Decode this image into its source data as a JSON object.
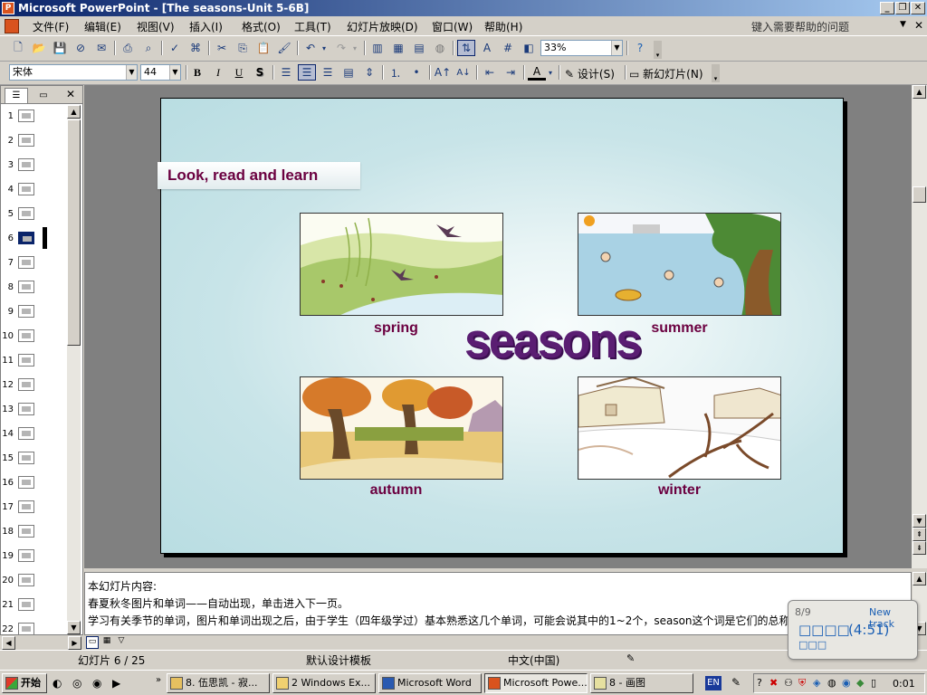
{
  "window": {
    "title": "Microsoft PowerPoint - [The seasons-Unit 5-6B]"
  },
  "menu": {
    "items": [
      "文件(F)",
      "编辑(E)",
      "视图(V)",
      "插入(I)",
      "格式(O)",
      "工具(T)",
      "幻灯片放映(D)",
      "窗口(W)",
      "帮助(H)"
    ],
    "help_placeholder": "键入需要帮助的问题"
  },
  "toolbar": {
    "zoom": "33%",
    "font_name": "宋体",
    "font_size": "44",
    "bold": "B",
    "italic": "I",
    "underline": "U",
    "shadow": "S",
    "design_label": "设计(S)",
    "new_slide_label": "新幻灯片(N)"
  },
  "slide_list": {
    "numbers": [
      "1",
      "2",
      "3",
      "4",
      "5",
      "6",
      "7",
      "8",
      "9",
      "10",
      "11",
      "12",
      "13",
      "14",
      "15",
      "16",
      "17",
      "18",
      "19",
      "20",
      "21",
      "22"
    ],
    "selected": 6
  },
  "slide": {
    "title": "Look, read and learn",
    "big_word": "seasons",
    "captions": {
      "spring": "spring",
      "summer": "summer",
      "autumn": "autumn",
      "winter": "winter"
    },
    "title_color": "#6b0040",
    "word_color": "#5a1d72"
  },
  "notes": {
    "line1": "本幻灯片内容:",
    "line2": "春夏秋冬图片和单词——自动出现，单击进入下一页。",
    "line3": "学习有关季节的单词，图片和单词出现之后，由于学生（四年级学过）基本熟悉这几个单词，可能会说其中的1~2个，season这个词是它们的总称。"
  },
  "status": {
    "slide_pos": "幻灯片 6 / 25",
    "template": "默认设计模板",
    "language": "中文(中国)"
  },
  "taskbar": {
    "start": "开始",
    "tasks": [
      "8. 伍思凯 - 寂...",
      "2 Windows Ex...",
      "Microsoft Word",
      "Microsoft Powe...",
      "8 - 画图"
    ],
    "active_index": 3,
    "lang": "EN",
    "clock": "0:01"
  },
  "player_popup": {
    "track": "8/9",
    "label": "New track",
    "name": "□□□□",
    "time": "(4:51)",
    "extra": "□□□"
  }
}
